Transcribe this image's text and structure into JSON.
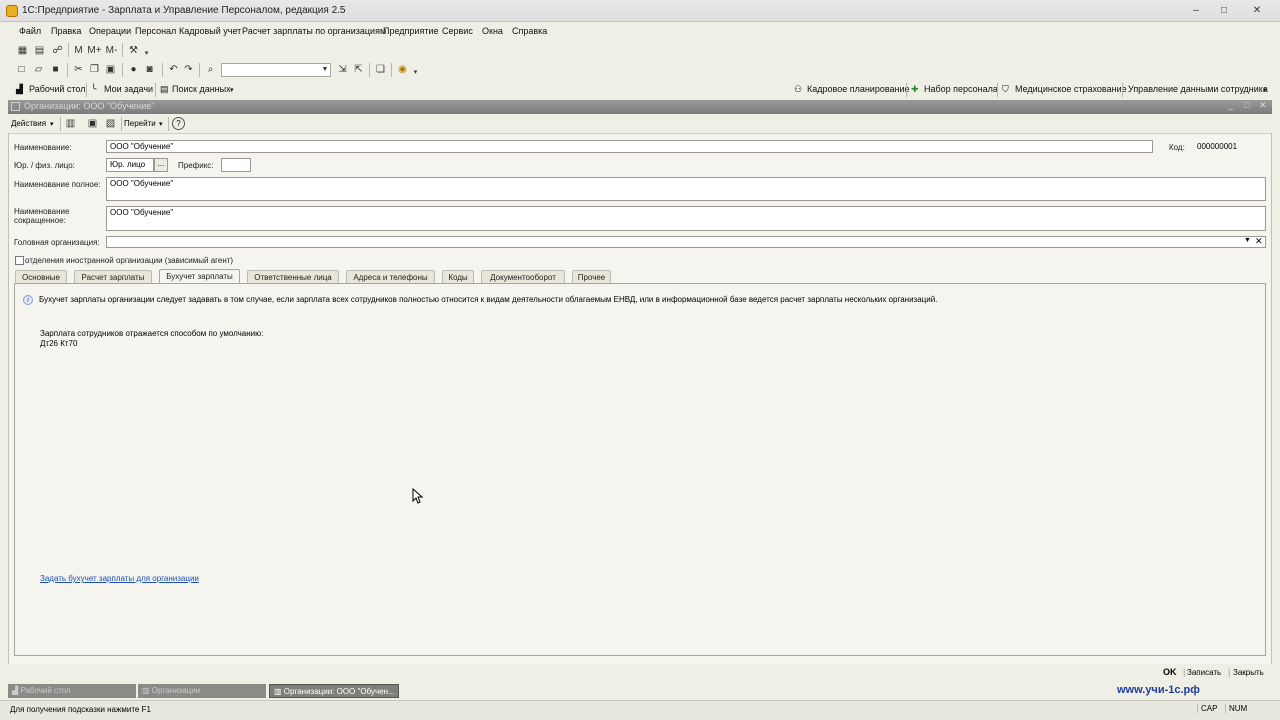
{
  "window": {
    "title": "1С:Предприятие - Зарплата и Управление Персоналом, редакция 2.5",
    "controls": [
      "–",
      "□",
      "✕"
    ]
  },
  "menu": [
    "Файл",
    "Правка",
    "Операции",
    "Персонал",
    "Кадровый учет",
    "Расчет зарплаты по организациям",
    "Предприятие",
    "Сервис",
    "Окна",
    "Справка"
  ],
  "toolbar2": {
    "search_value": ""
  },
  "quickbar": {
    "left": [
      "Рабочий стол",
      "Мои задачи",
      "Поиск данных"
    ],
    "right": [
      "Кадровое планирование",
      "Набор персонала",
      "Медицинское страхование",
      "Управление данными сотрудника"
    ]
  },
  "doc": {
    "title": "Организации: ООО \"Обучение\"",
    "actions": {
      "actions_label": "Действия",
      "goto_label": "Перейти",
      "help": "?"
    },
    "form": {
      "name_label": "Наименование:",
      "name_value": "ООО \"Обучение\"",
      "code_label": "Код:",
      "code_value": "000000001",
      "legal_label": "Юр. / физ. лицо:",
      "legal_value": "Юр. лицо",
      "legal_btn": "...",
      "prefix_label": "Префикс:",
      "prefix_value": "",
      "fullname_label": "Наименование полное:",
      "fullname_value": "ООО \"Обучение\"",
      "shortname_label_1": "Наименование",
      "shortname_label_2": "сокращенное:",
      "shortname_value": "ООО \"Обучение\"",
      "parent_label": "Головная организация:",
      "parent_value": "",
      "foreign_checkbox": "отделения иностранной организации (зависимый агент)"
    },
    "tabs": [
      {
        "label": "Основные",
        "active": false
      },
      {
        "label": "Расчет зарплаты",
        "active": false
      },
      {
        "label": "Бухучет зарплаты",
        "active": true
      },
      {
        "label": "Ответственные лица",
        "active": false
      },
      {
        "label": "Адреса и телефоны",
        "active": false
      },
      {
        "label": "Коды",
        "active": false
      },
      {
        "label": "Документооборот",
        "active": false
      },
      {
        "label": "Прочее",
        "active": false
      }
    ],
    "panel": {
      "info": "Бухучет зарплаты организации следует задавать в том случае, если зарплата всех сотрудников полностью относится к видам деятельности облагаемым ЕНВД, или в информационной базе ведется расчет зарплаты нескольких организаций.",
      "default_line1": "Зарплата сотрудников отражается способом по умолчанию:",
      "default_line2": "Дт26 Кт70",
      "link": "Задать бухучет зарплаты для организации"
    },
    "buttons": {
      "ok": "OK",
      "save": "Записать",
      "close": "Закрыть"
    }
  },
  "taskbar": [
    "Рабочий стол",
    "Организации",
    "Организации: ООО \"Обучен..."
  ],
  "watermark": "www.учи-1с.рф",
  "status": {
    "hint": "Для получения подсказки нажмите F1",
    "cap": "CAP",
    "num": "NUM"
  },
  "colors": {
    "accent": "#1c4fb0",
    "doc_titlebar": "#8a8a8a",
    "background": "#f0efe6"
  }
}
